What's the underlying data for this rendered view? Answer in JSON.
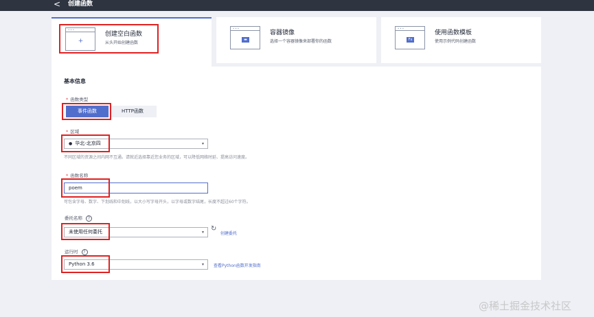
{
  "header": {
    "back_glyph": "<",
    "title": "创建函数"
  },
  "template_cards": [
    {
      "title": "创建空白函数",
      "desc": "从头开始创建函数",
      "icon": "blank-function-icon",
      "glyph": "+"
    },
    {
      "title": "容器镜像",
      "desc": "选择一个容器镜像来部署你的函数",
      "icon": "container-image-icon",
      "glyph": "▬"
    },
    {
      "title": "使用函数模板",
      "desc": "使用示例代码创建函数",
      "icon": "function-template-icon",
      "glyph": "Fx"
    }
  ],
  "form": {
    "section_title": "基本信息",
    "required_mark": "*",
    "function_type": {
      "label": "函数类型",
      "options": [
        "事件函数",
        "HTTP函数"
      ],
      "selected": "事件函数"
    },
    "region": {
      "label": "区域",
      "value": "华北-北京四",
      "hint": "不同区域的资源之间内网不互通。请就近选择靠近您业务的区域，可以降低网络时延、提高访问速度。"
    },
    "function_name": {
      "label": "函数名称",
      "value": "poem",
      "hint": "可包含字母、数字、下划线和中划线，以大小写字母开头，以字母或数字结尾，长度不超过60个字符。"
    },
    "agency": {
      "label": "委托名称",
      "help": "?",
      "value": "未使用任何委托",
      "refresh_glyph": "↻",
      "link": "创建委托"
    },
    "runtime": {
      "label": "运行时",
      "help": "?",
      "value": "Python 3.6",
      "link": "查看Python函数开发指南"
    }
  },
  "icons": {
    "dropdown": "▾",
    "location": "location-pin-icon"
  },
  "colors": {
    "accent": "#526ecc",
    "topbar": "#2e3440",
    "highlight": "#e02020",
    "required": "#e54545"
  },
  "watermark": "@稀土掘金技术社区"
}
